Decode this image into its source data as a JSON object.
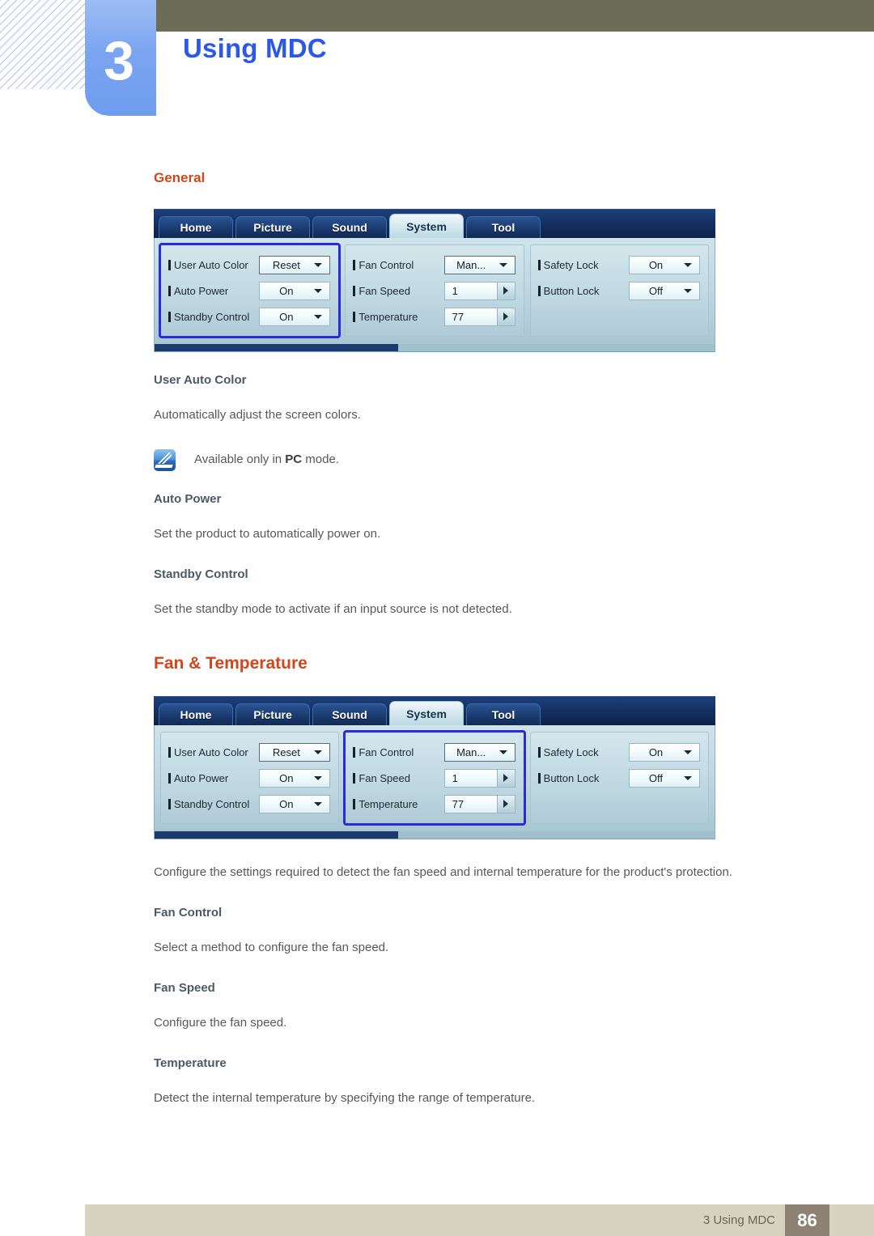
{
  "header": {
    "chapter_number": "3",
    "chapter_title": "Using MDC"
  },
  "content": {
    "general_heading": "General",
    "fan_temp_heading": "Fan & Temperature",
    "items": {
      "user_auto_color_head": "User Auto Color",
      "user_auto_color_text": "Automatically adjust the screen colors.",
      "note_text_prefix": "Available only in ",
      "note_text_bold": "PC",
      "note_text_suffix": " mode.",
      "auto_power_head": "Auto Power",
      "auto_power_text": "Set the product to automatically power on.",
      "standby_control_head": "Standby Control",
      "standby_control_text": "Set the standby mode to activate if an input source is not detected.",
      "fan_temp_intro": "Configure the settings required to detect the fan speed and internal temperature for the product's protection.",
      "fan_control_head": "Fan Control",
      "fan_control_text": "Select a method to configure the fan speed.",
      "fan_speed_head": "Fan Speed",
      "fan_speed_text": "Configure the fan speed.",
      "temperature_head": "Temperature",
      "temperature_text": "Detect the internal temperature by specifying the range of temperature."
    }
  },
  "mdc_panel": {
    "tabs": [
      {
        "label": "Home",
        "active": false
      },
      {
        "label": "Picture",
        "active": false
      },
      {
        "label": "Sound",
        "active": false
      },
      {
        "label": "System",
        "active": true
      },
      {
        "label": "Tool",
        "active": false
      }
    ],
    "group_general": {
      "rows": [
        {
          "label": "User Auto Color",
          "value": "Reset",
          "control": "dropdown-boxed"
        },
        {
          "label": "Auto Power",
          "value": "On",
          "control": "dropdown"
        },
        {
          "label": "Standby Control",
          "value": "On",
          "control": "dropdown"
        }
      ]
    },
    "group_fan": {
      "rows": [
        {
          "label": "Fan Control",
          "value": "Man...",
          "control": "dropdown-boxed"
        },
        {
          "label": "Fan Speed",
          "value": "1",
          "control": "spinner"
        },
        {
          "label": "Temperature",
          "value": "77",
          "control": "spinner"
        }
      ]
    },
    "group_lock": {
      "rows": [
        {
          "label": "Safety Lock",
          "value": "On",
          "control": "dropdown"
        },
        {
          "label": "Button Lock",
          "value": "Off",
          "control": "dropdown"
        }
      ]
    }
  },
  "footer": {
    "label": "3 Using MDC",
    "page_number": "86"
  },
  "colors": {
    "heading_orange": "#d2461a",
    "chapter_blue": "#2b58e8",
    "olive_bar": "#6d6c56",
    "footer_beige": "#d8d3bf",
    "footer_pagebox": "#8d8273",
    "highlight_outline": "#2b2bdd"
  }
}
